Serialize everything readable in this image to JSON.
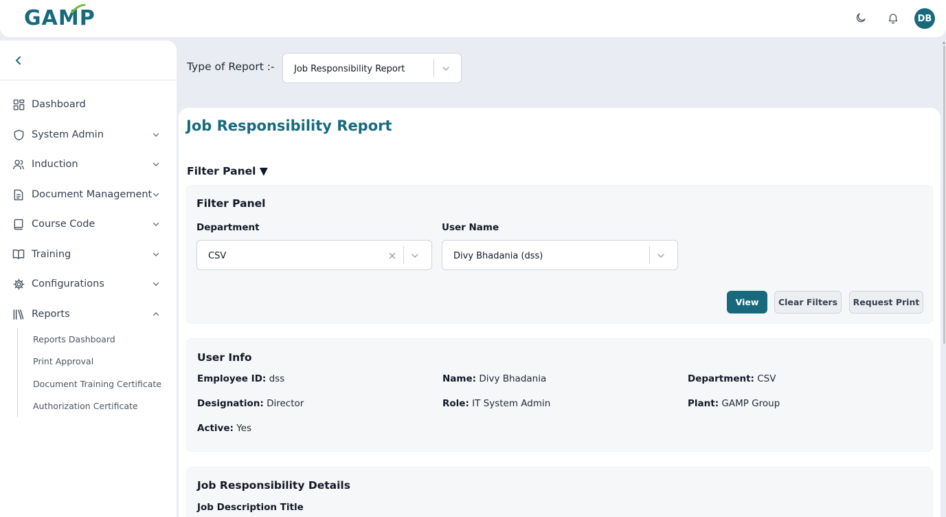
{
  "app": {
    "logo_text": "GAMP",
    "avatar_initials": "DB"
  },
  "header": {
    "icons": [
      "moon-icon",
      "bell-icon"
    ]
  },
  "sidebar": {
    "items": [
      {
        "label": "Dashboard",
        "icon": "dashboard-icon",
        "expandable": false
      },
      {
        "label": "System Admin",
        "icon": "shield-icon",
        "expandable": true
      },
      {
        "label": "Induction",
        "icon": "users-icon",
        "expandable": true
      },
      {
        "label": "Document Management",
        "icon": "document-icon",
        "expandable": true
      },
      {
        "label": "Course Code",
        "icon": "book-icon",
        "expandable": true
      },
      {
        "label": "Training",
        "icon": "open-book-icon",
        "expandable": true
      },
      {
        "label": "Configurations",
        "icon": "gear-icon",
        "expandable": true
      },
      {
        "label": "Reports",
        "icon": "library-icon",
        "expandable": true,
        "expanded": true
      }
    ],
    "reports_sub_items": [
      "Reports Dashboard",
      "Print Approval",
      "Document Training Certificate",
      "Authorization Certificate"
    ]
  },
  "main": {
    "type_label": "Type of Report :-",
    "type_value": "Job Responsibility Report",
    "report_title": "Job Responsibility Report",
    "filter_toggle": "Filter Panel ▼",
    "filter_panel": {
      "title": "Filter Panel",
      "department_label": "Department",
      "department_value": "CSV",
      "username_label": "User Name",
      "username_value": "Divy Bhadania (dss)",
      "view_button": "View",
      "clear_button": "Clear Filters",
      "print_button": "Request Print"
    },
    "user_info": {
      "title": "User Info",
      "employee_id_label": "Employee ID:",
      "employee_id": "dss",
      "name_label": "Name:",
      "name": "Divy Bhadania",
      "department_label": "Department:",
      "department": "CSV",
      "designation_label": "Designation:",
      "designation": "Director",
      "role_label": "Role:",
      "role": "IT System Admin",
      "plant_label": "Plant:",
      "plant": "GAMP Group",
      "active_label": "Active:",
      "active": "Yes"
    },
    "job_details": {
      "title": "Job Responsibility Details",
      "description_title_label": "Job Description Title"
    }
  },
  "colors": {
    "accent": "#176a7c",
    "background": "#e9edf3"
  }
}
